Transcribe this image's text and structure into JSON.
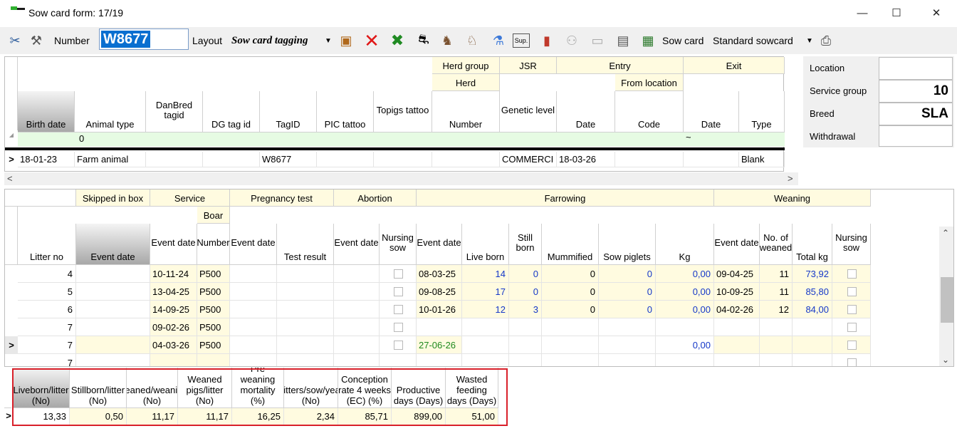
{
  "window": {
    "title": "Sow card form: 17/19",
    "minimize": "—",
    "maximize": "☐",
    "close": "✕"
  },
  "toolbar": {
    "number_label": "Number",
    "number_value": "W8677",
    "layout_label": "Layout",
    "layout_value": "Sow card tagging",
    "sowcard_label": "Sow card",
    "sowcard_value": "Standard sowcard",
    "sup_label": "Sup."
  },
  "top_grid": {
    "group_headers": {
      "herd_group": "Herd group",
      "herd": "Herd",
      "jsr": "JSR",
      "entry": "Entry",
      "from_location": "From location",
      "exit": "Exit"
    },
    "columns": [
      "Birth date",
      "Animal type",
      "DanBred tagid",
      "DG tag id",
      "TagID",
      "PIC tattoo",
      "Topigs tattoo",
      "Number",
      "Genetic level",
      "Date",
      "Code",
      "Date",
      "Type"
    ],
    "filter_row": {
      "animal_type": "0",
      "exit_date": "~"
    },
    "row": [
      "18-01-23",
      "Farm animal",
      "",
      "",
      "W8677",
      "",
      "",
      "",
      "COMMERCI",
      "18-03-26",
      "",
      "",
      "Blank"
    ]
  },
  "side_panel": {
    "location_label": "Location",
    "location_value": "",
    "service_group_label": "Service group",
    "service_group_value": "10",
    "breed_label": "Breed",
    "breed_value": "SLA",
    "withdrawal_label": "Withdrawal",
    "withdrawal_value": ""
  },
  "litter_grid": {
    "group_headers": {
      "skipped": "Skipped in box",
      "service": "Service",
      "boar": "Boar",
      "pregnancy": "Pregnancy test",
      "abortion": "Abortion",
      "farrowing": "Farrowing",
      "weaning": "Weaning"
    },
    "columns": [
      "Litter no",
      "Event date",
      "Event date",
      "Number",
      "Event date",
      "Test result",
      "Event date",
      "Nursing sow",
      "Event date",
      "Live born",
      "Still born",
      "Mummified",
      "Sow piglets",
      "Kg",
      "Event date",
      "No. of weaned",
      "Total kg",
      "Nursing sow"
    ],
    "rows": [
      {
        "litter": "4",
        "svc_date": "10-11-24",
        "svc_boar": "P500",
        "far_date": "08-03-25",
        "live": "14",
        "still": "0",
        "mum": "0",
        "sowp": "0",
        "kg": "0,00",
        "wea_date": "09-04-25",
        "weaned": "11",
        "total_kg": "73,92"
      },
      {
        "litter": "5",
        "svc_date": "13-04-25",
        "svc_boar": "P500",
        "far_date": "09-08-25",
        "live": "17",
        "still": "0",
        "mum": "0",
        "sowp": "0",
        "kg": "0,00",
        "wea_date": "10-09-25",
        "weaned": "11",
        "total_kg": "85,80"
      },
      {
        "litter": "6",
        "svc_date": "14-09-25",
        "svc_boar": "P500",
        "far_date": "10-01-26",
        "live": "12",
        "still": "3",
        "mum": "0",
        "sowp": "0",
        "kg": "0,00",
        "wea_date": "04-02-26",
        "weaned": "12",
        "total_kg": "84,00"
      },
      {
        "litter": "7",
        "svc_date": "09-02-26",
        "svc_boar": "P500",
        "far_date": "",
        "live": "",
        "still": "",
        "mum": "",
        "sowp": "",
        "kg": "",
        "wea_date": "",
        "weaned": "",
        "total_kg": ""
      },
      {
        "litter": "7",
        "svc_date": "04-03-26",
        "svc_boar": "P500",
        "far_date": "27-06-26",
        "live": "",
        "still": "",
        "mum": "",
        "sowp": "",
        "kg": "0,00",
        "wea_date": "",
        "weaned": "",
        "total_kg": ""
      },
      {
        "litter": "7",
        "svc_date": "",
        "svc_boar": "",
        "far_date": "",
        "live": "",
        "still": "",
        "mum": "",
        "sowp": "",
        "kg": "",
        "wea_date": "",
        "weaned": "",
        "total_kg": ""
      }
    ]
  },
  "kpi_grid": {
    "columns": [
      "Liveborn/litter (No)",
      "Stillborn/litter (No)",
      "Weaned/weaning (No)",
      "Weaned pigs/litter (No)",
      "Pre weaning mortality (%)",
      "Litters/sow/year (No)",
      "Conception rate 4 weeks (EC) (%)",
      "Productive days (Days)",
      "Wasted feeding days (Days)"
    ],
    "values": [
      "13,33",
      "0,50",
      "11,17",
      "11,17",
      "16,25",
      "2,34",
      "85,71",
      "899,00",
      "51,00"
    ]
  }
}
